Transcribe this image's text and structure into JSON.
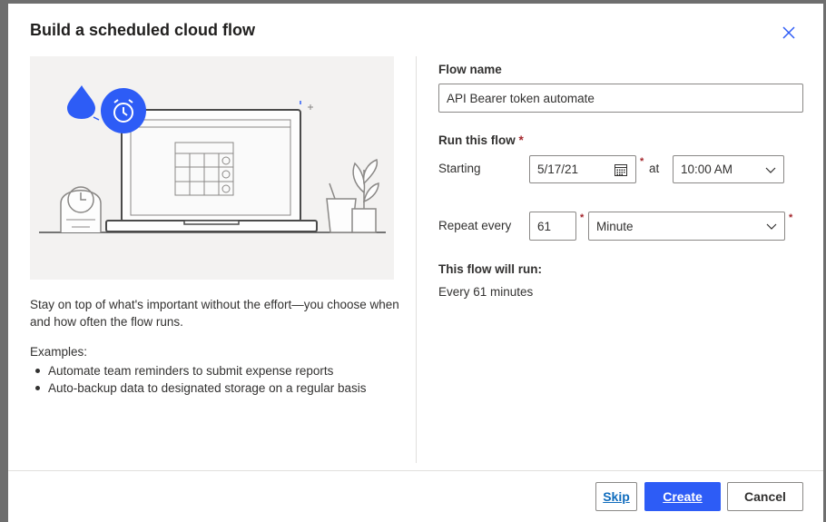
{
  "dialog": {
    "title": "Build a scheduled cloud flow",
    "description": "Stay on top of what's important without the effort—you choose when and how often the flow runs.",
    "examples_title": "Examples:",
    "examples": [
      "Automate team reminders to submit expense reports",
      "Auto-backup data to designated storage on a regular basis"
    ]
  },
  "form": {
    "flow_name_label": "Flow name",
    "flow_name_value": "API Bearer token automate",
    "run_label": "Run this flow",
    "required_mark": "*",
    "starting_label": "Starting",
    "date_value": "5/17/21",
    "at_label": "at",
    "time_value": "10:00 AM",
    "repeat_label": "Repeat every",
    "interval_value": "61",
    "unit_value": "Minute",
    "will_run_label": "This flow will run:",
    "will_run_text": "Every 61 minutes"
  },
  "buttons": {
    "skip": "Skip",
    "create": "Create",
    "cancel": "Cancel"
  },
  "colors": {
    "accent": "#2d5cf6",
    "required": "#a4262c"
  }
}
